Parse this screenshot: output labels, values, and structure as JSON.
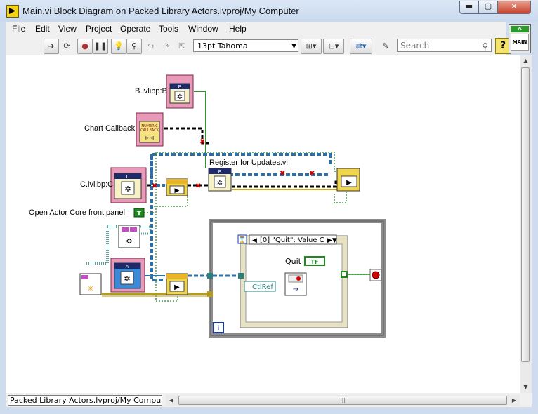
{
  "window": {
    "title": "Main.vi Block Diagram on Packed Library Actors.lvproj/My Computer",
    "buttons": {
      "minimize": "▬",
      "maximize": "▢",
      "close": "✕"
    }
  },
  "menu": [
    "File",
    "Edit",
    "View",
    "Project",
    "Operate",
    "Tools",
    "Window",
    "Help"
  ],
  "toolbar": {
    "font_value": "13pt Tahoma",
    "search_placeholder": "Search",
    "help_label": "?"
  },
  "connector_pane": {
    "top": "A",
    "name": "MAIN"
  },
  "diagram": {
    "labels": {
      "b_lib": "B.lvlibp:B",
      "chart_callback": "Chart Callback",
      "c_lib": "C.lvlibp:C",
      "register": "Register for Updates.vi",
      "open_core": "Open Actor Core front panel",
      "event_case": "[0] \"Quit\": Value C",
      "quit": "Quit",
      "ctlref": "CtlRef",
      "tf": "TF",
      "loop_index": "i",
      "true_const": "T"
    },
    "icons": {
      "b_letter": "B",
      "c_letter": "C",
      "a_letter": "A",
      "callback_text_1": "NUMERIC",
      "callback_text_2": "CALLBACK"
    }
  },
  "statusbar": {
    "path": "Packed Library Actors.lvproj/My Computer"
  },
  "colors": {
    "accent": "#4a8ab8",
    "class_wire": "#2a7f7f",
    "error_wire": "#b59b1a",
    "bool_wire": "#2f8f2f",
    "stop": "#d00000"
  }
}
